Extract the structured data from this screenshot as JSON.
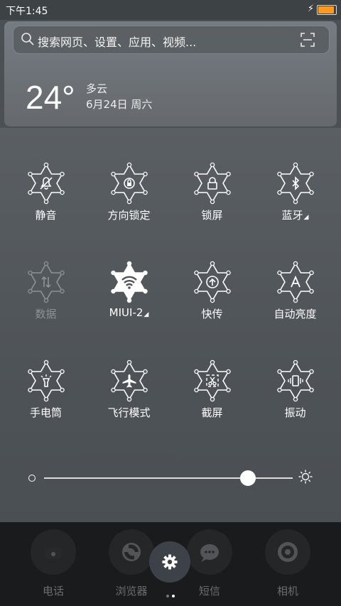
{
  "status_bar": {
    "time": "下午1:45",
    "battery_level": 0.9,
    "charging_icon": "bolt-icon",
    "battery_color": "#ff9a1f"
  },
  "search": {
    "placeholder": "搜索网页、设置、应用、视频..."
  },
  "weather": {
    "temperature": "24°",
    "condition": "多云",
    "date": "6月24日 周六"
  },
  "toggles": [
    {
      "label": "静音",
      "icon": "silent-icon",
      "active": false,
      "disabled": false
    },
    {
      "label": "方向锁定",
      "icon": "rotation-lock-icon",
      "active": false,
      "disabled": false
    },
    {
      "label": "锁屏",
      "icon": "lock-icon",
      "active": false,
      "disabled": false
    },
    {
      "label": "蓝牙",
      "icon": "bluetooth-icon",
      "active": false,
      "disabled": false,
      "has_menu": true
    },
    {
      "label": "数据",
      "icon": "mobile-data-icon",
      "active": false,
      "disabled": true
    },
    {
      "label": "MIUI-2",
      "icon": "wifi-icon",
      "active": true,
      "disabled": false,
      "has_menu": true
    },
    {
      "label": "快传",
      "icon": "share-upload-icon",
      "active": false,
      "disabled": false
    },
    {
      "label": "自动亮度",
      "icon": "auto-brightness-icon",
      "active": false,
      "disabled": false
    },
    {
      "label": "手电筒",
      "icon": "flashlight-icon",
      "active": false,
      "disabled": false
    },
    {
      "label": "飞行模式",
      "icon": "airplane-icon",
      "active": false,
      "disabled": false
    },
    {
      "label": "截屏",
      "icon": "screenshot-icon",
      "active": false,
      "disabled": false
    },
    {
      "label": "振动",
      "icon": "vibrate-icon",
      "active": false,
      "disabled": false
    }
  ],
  "brightness": {
    "level": 0.82
  },
  "dock": {
    "apps": [
      {
        "label": "电话",
        "icon": "phone-icon"
      },
      {
        "label": "浏览器",
        "icon": "browser-icon"
      },
      {
        "label": "短信",
        "icon": "messages-icon"
      },
      {
        "label": "相机",
        "icon": "camera-icon"
      }
    ],
    "fab_icon": "gear-icon",
    "page_count": 2,
    "current_page": 2
  }
}
